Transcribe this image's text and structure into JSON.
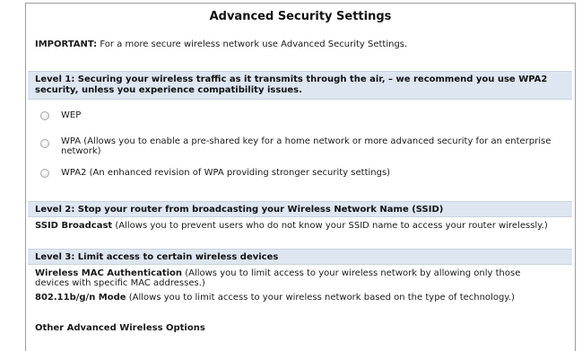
{
  "title": "Advanced Security Settings",
  "important": {
    "label": "IMPORTANT:",
    "text": " For a more secure wireless network use Advanced Security Settings."
  },
  "level1": {
    "heading": "Level 1: Securing your wireless traffic as it transmits through the air, – we recommend you use WPA2 security, unless you experience compatibility issues.",
    "options": [
      {
        "label": "WEP",
        "selected": false
      },
      {
        "label": "WPA (Allows you to enable a pre-shared key for a home network or more advanced security for an enterprise network)",
        "selected": false
      },
      {
        "label": "WPA2 (An enhanced revision of WPA providing stronger security settings)",
        "selected": false
      }
    ]
  },
  "level2": {
    "heading": "Level 2: Stop your router from broadcasting your Wireless Network Name (SSID)",
    "ssid_label": "SSID Broadcast",
    "ssid_text": " (Allows you to prevent users who do not know your SSID name to access your router wirelessly.)"
  },
  "level3": {
    "heading": "Level 3: Limit access to certain wireless devices",
    "mac_label": "Wireless MAC Authentication",
    "mac_text": " (Allows you to limit access to your wireless network by allowing only those devices with specific MAC addresses.)",
    "mode_label": "802.11b/g/n Mode",
    "mode_text": " (Allows you to limit access to your wireless network based on the type of technology.)"
  },
  "other": {
    "heading": "Other Advanced Wireless Options"
  }
}
